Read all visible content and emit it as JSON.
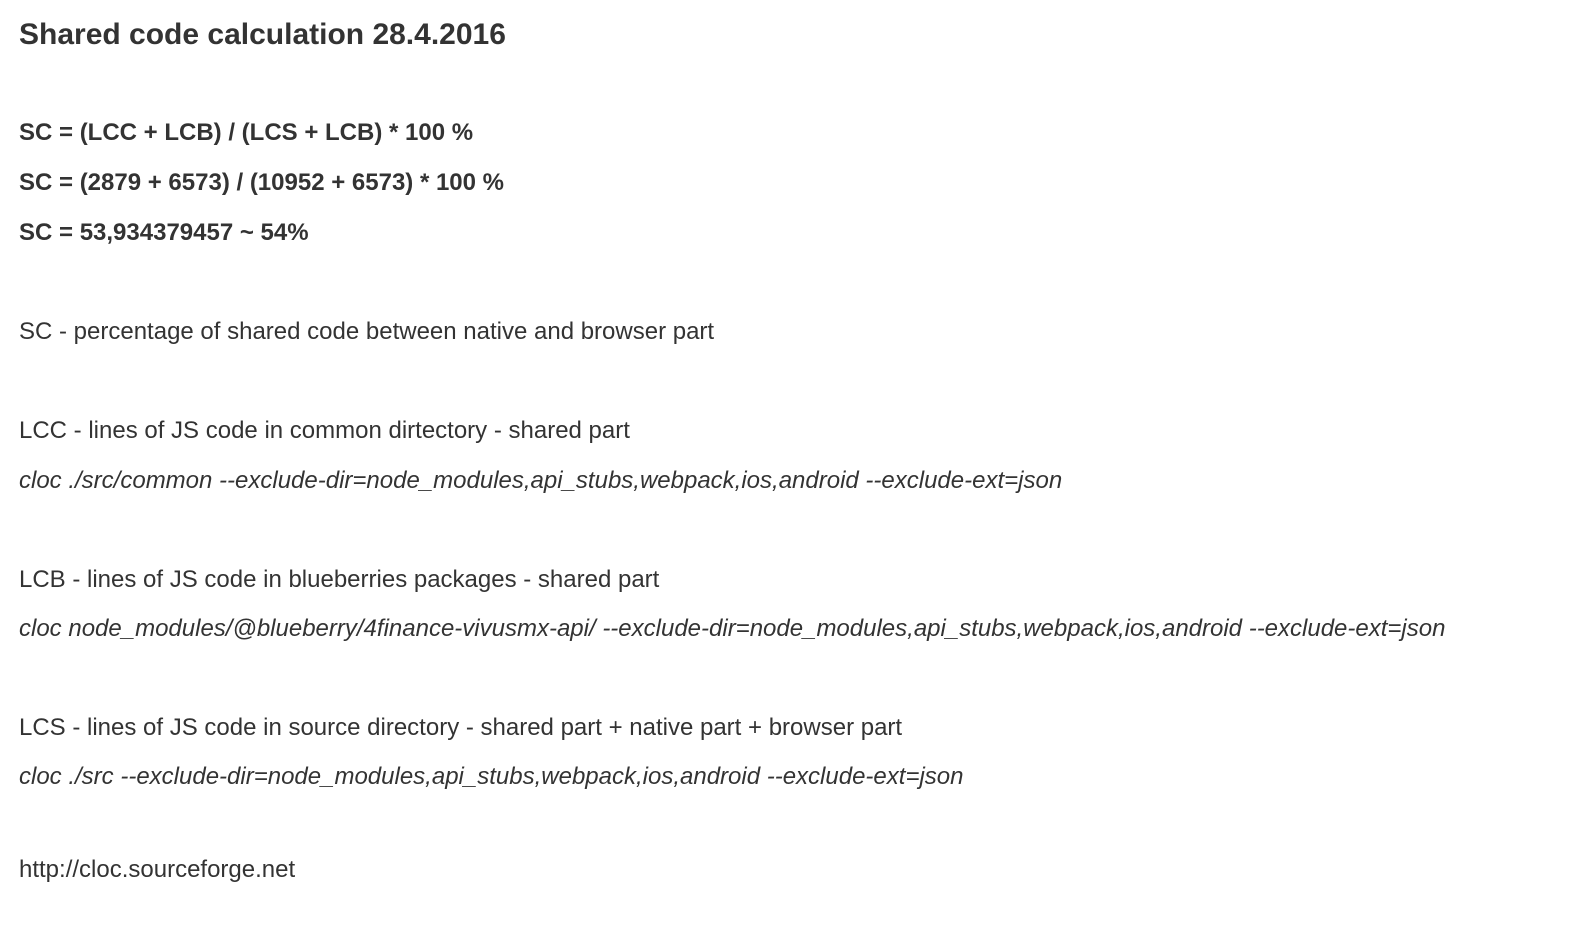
{
  "title": "Shared code calculation 28.4.2016",
  "formula": [
    "SC = (LCC + LCB) / (LCS + LCB) * 100 %",
    "SC = (2879 + 6573) / (10952 + 6573) * 100 %",
    "SC = 53,934379457 ~ 54%"
  ],
  "sc_desc": "SC - percentage of shared code between native and browser part",
  "lcc": {
    "desc": "LCC - lines of JS code in common dirtectory - shared part",
    "cmd": "cloc ./src/common --exclude-dir=node_modules,api_stubs,webpack,ios,android --exclude-ext=json"
  },
  "lcb": {
    "desc": "LCB - lines of JS code in blueberries packages - shared part",
    "cmd": "cloc node_modules/@blueberry/4finance-vivusmx-api/ --exclude-dir=node_modules,api_stubs,webpack,ios,android --exclude-ext=json"
  },
  "lcs": {
    "desc": "LCS - lines of JS code in source directory - shared part + native part + browser part",
    "cmd": "cloc ./src --exclude-dir=node_modules,api_stubs,webpack,ios,android --exclude-ext=json"
  },
  "link": "http://cloc.sourceforge.net"
}
